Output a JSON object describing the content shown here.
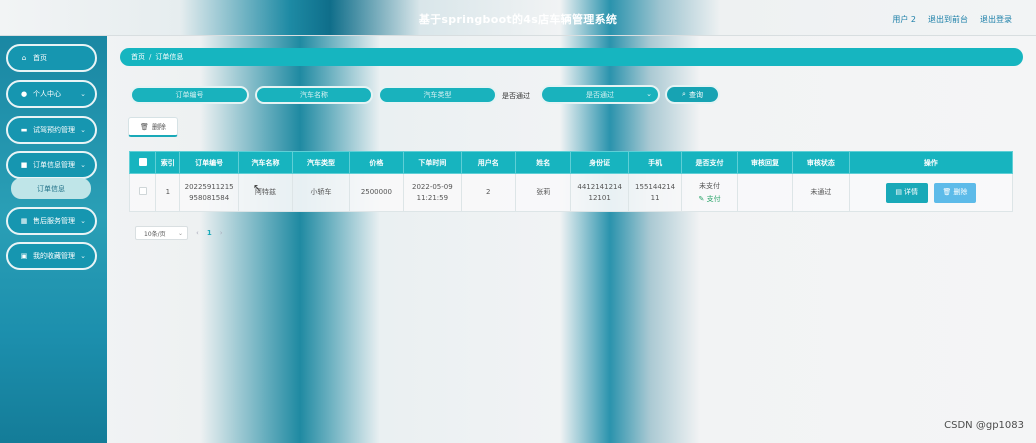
{
  "header": {
    "title": "基于springboot的4s店车辆管理系统",
    "links": [
      "用户 2",
      "退出到前台",
      "退出登录"
    ]
  },
  "sidebar": {
    "items": [
      {
        "label": "首页",
        "icon": "home-icon",
        "glyph": "⌂",
        "chevron": false
      },
      {
        "label": "个人中心",
        "icon": "user-icon",
        "glyph": "●",
        "chevron": true
      },
      {
        "label": "试驾预约管理",
        "icon": "monitor-icon",
        "glyph": "▬",
        "chevron": true
      },
      {
        "label": "订单信息管理",
        "icon": "lock-icon",
        "glyph": "■",
        "chevron": true
      },
      {
        "label": "售后服务管理",
        "icon": "grid-icon",
        "glyph": "▦",
        "chevron": true
      },
      {
        "label": "我的收藏管理",
        "icon": "folder-icon",
        "glyph": "▣",
        "chevron": true
      }
    ],
    "submenu": {
      "label": "订单信息"
    }
  },
  "breadcrumb": {
    "home": "首页",
    "separator": "/",
    "current": "订单信息"
  },
  "search": {
    "order_no_placeholder": "订单编号",
    "car_name_placeholder": "汽车名称",
    "car_type_placeholder": "汽车类型",
    "approve_label": "是否通过",
    "approve_select_value": "是否通过",
    "query_label": "查询"
  },
  "toolbar": {
    "delete_label": "删除"
  },
  "table": {
    "columns": [
      "索引",
      "订单编号",
      "汽车名称",
      "汽车类型",
      "价格",
      "下单时间",
      "用户名",
      "姓名",
      "身份证",
      "手机",
      "是否支付",
      "审核回复",
      "审核状态",
      "操作"
    ],
    "rows": [
      {
        "index": "1",
        "order_no": "20225911215958081584",
        "car_name": "阿特兹",
        "car_type": "小轿车",
        "price": "2500000",
        "order_time": "2022-05-09 11:21:59",
        "username": "2",
        "name": "张莉",
        "id_card": "441214121412101",
        "phone": "15514421411",
        "paid_status": "未支付",
        "pay_link": "支付",
        "review_reply": "",
        "review_status": "未通过",
        "detail_label": "详情",
        "delete_label": "删除"
      }
    ]
  },
  "pagination": {
    "page_size": "10条/页",
    "current_page": "1"
  },
  "watermark": "CSDN @gp1083",
  "colors": {
    "accent": "#17b4bf",
    "sidebar": "#1a87a3",
    "detail_button": "#19a9b8",
    "delete_button": "#5dbbe9"
  }
}
